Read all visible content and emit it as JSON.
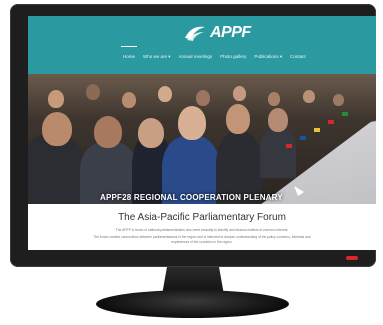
{
  "site": {
    "logo_text": "APPF",
    "logo_icon": "swoosh-logo-icon",
    "nav": [
      {
        "label": "Home",
        "active": true
      },
      {
        "label": "Who we are ▾",
        "active": false
      },
      {
        "label": "Annual meetings",
        "active": false
      },
      {
        "label": "Photo gallery",
        "active": false
      },
      {
        "label": "Publications ▾",
        "active": false
      },
      {
        "label": "Contact",
        "active": false
      }
    ]
  },
  "hero": {
    "caption": "APPF28 REGIONAL COOPERATION PLENARY",
    "arrow_icon": "chevron-down-icon"
  },
  "content": {
    "title": "The Asia-Pacific Parliamentary Forum",
    "paragraph1": "The APPF is forum of national parliamentarians who meet annually to identify and discuss matters of common interest.",
    "paragraph2": "The forum creates connections between parliamentarians in the region and is intended to deepen understanding of the policy concerns, interests and experiences of the countries in the region."
  },
  "colors": {
    "header": "#2a9aa0",
    "monitor": "#1e1e1e",
    "power_led": "#d9272e"
  }
}
